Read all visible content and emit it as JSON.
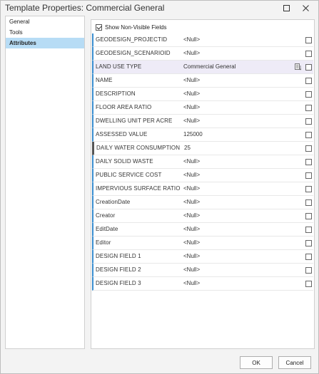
{
  "window": {
    "title": "Template Properties: Commercial General"
  },
  "nav": {
    "items": [
      {
        "label": "General",
        "active": false
      },
      {
        "label": "Tools",
        "active": false
      },
      {
        "label": "Attributes",
        "active": true
      }
    ]
  },
  "attributes": {
    "show_non_visible_label": "Show Non-Visible Fields",
    "show_non_visible_checked": true,
    "fields": [
      {
        "name": "GEODESIGN_PROJECTID",
        "value": "<Null>"
      },
      {
        "name": "GEODESIGN_SCENARIOID",
        "value": "<Null>"
      },
      {
        "name": "LAND USE TYPE",
        "value": "Commercial General"
      },
      {
        "name": "NAME",
        "value": "<Null>"
      },
      {
        "name": "DESCRIPTION",
        "value": "<Null>"
      },
      {
        "name": "FLOOR AREA RATIO",
        "value": "<Null>"
      },
      {
        "name": "DWELLING UNIT PER ACRE",
        "value": "<Null>"
      },
      {
        "name": "ASSESSED VALUE",
        "value": "125000"
      },
      {
        "name": "DAILY WATER CONSUMPTION",
        "value": "25"
      },
      {
        "name": "DAILY SOLID WASTE",
        "value": "<Null>"
      },
      {
        "name": "PUBLIC SERVICE COST",
        "value": "<Null>"
      },
      {
        "name": "IMPERVIOUS SURFACE RATIO",
        "value": "<Null>"
      },
      {
        "name": "CreationDate",
        "value": "<Null>"
      },
      {
        "name": "Creator",
        "value": "<Null>"
      },
      {
        "name": "EditDate",
        "value": "<Null>"
      },
      {
        "name": "Editor",
        "value": "<Null>"
      },
      {
        "name": "DESIGN FIELD 1",
        "value": "<Null>"
      },
      {
        "name": "DESIGN FIELD 2",
        "value": "<Null>"
      },
      {
        "name": "DESIGN FIELD 3",
        "value": "<Null>"
      }
    ]
  },
  "buttons": {
    "ok": "OK",
    "cancel": "Cancel"
  },
  "colors": {
    "accent": "#3b8ed0",
    "nav_selected": "#b7dcf5",
    "row_highlight": "#eeebf7"
  }
}
